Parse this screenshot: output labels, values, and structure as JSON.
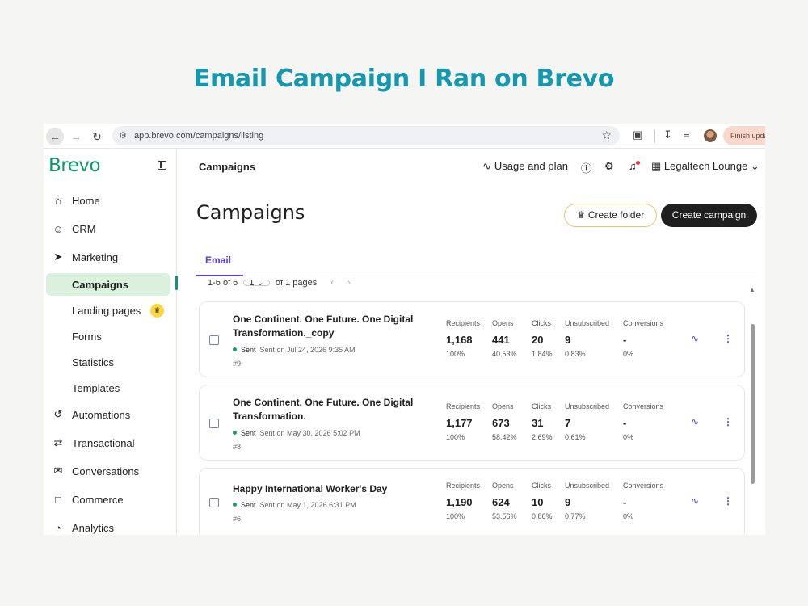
{
  "headline": "Email Campaign I Ran on Brevo",
  "browser": {
    "url": "app.brevo.com/campaigns/listing",
    "finish_label": "Finish upda"
  },
  "sidebar": {
    "logo": "Brevo",
    "items": [
      {
        "label": "Home",
        "icon": "home-icon"
      },
      {
        "label": "CRM",
        "icon": "user-circle-icon"
      },
      {
        "label": "Marketing",
        "icon": "send-icon"
      },
      {
        "label": "Automations",
        "icon": "automation-icon"
      },
      {
        "label": "Transactional",
        "icon": "transfer-icon"
      },
      {
        "label": "Conversations",
        "icon": "chat-icon"
      },
      {
        "label": "Commerce",
        "icon": "shopping-bag-icon"
      },
      {
        "label": "Analytics",
        "icon": "pie-chart-icon"
      }
    ],
    "marketing_sub": [
      {
        "label": "Campaigns",
        "active": true
      },
      {
        "label": "Landing pages"
      },
      {
        "label": "Forms"
      },
      {
        "label": "Statistics"
      },
      {
        "label": "Templates"
      }
    ]
  },
  "topbar": {
    "title": "Campaigns",
    "usage": "Usage and plan",
    "account": "Legaltech Lounge"
  },
  "page": {
    "title": "Campaigns",
    "create_folder": "Create folder",
    "create_campaign": "Create campaign",
    "tab": "Email",
    "pager_range": "1-6 of 6",
    "pager_page": "1",
    "pager_total": "of 1 pages"
  },
  "stat_labels": {
    "recipients": "Recipients",
    "opens": "Opens",
    "clicks": "Clicks",
    "unsubscribed": "Unsubscribed",
    "conversions": "Conversions"
  },
  "campaigns": [
    {
      "title": "One Continent. One Future. One Digital Transformation._copy",
      "status": "Sent",
      "sent_on": "Sent on Jul 24, 2026 9:35 AM",
      "id": "#9",
      "recipients": "1,168",
      "recipients_pct": "100%",
      "opens": "441",
      "opens_pct": "40.53%",
      "clicks": "20",
      "clicks_pct": "1.84%",
      "unsubscribed": "9",
      "unsubscribed_pct": "0.83%",
      "conversions": "-",
      "conversions_pct": "0%"
    },
    {
      "title": "One Continent. One Future. One Digital Transformation.",
      "status": "Sent",
      "sent_on": "Sent on May 30, 2026 5:02 PM",
      "id": "#8",
      "recipients": "1,177",
      "recipients_pct": "100%",
      "opens": "673",
      "opens_pct": "58.42%",
      "clicks": "31",
      "clicks_pct": "2.69%",
      "unsubscribed": "7",
      "unsubscribed_pct": "0.61%",
      "conversions": "-",
      "conversions_pct": "0%"
    },
    {
      "title": "Happy International Worker's Day",
      "status": "Sent",
      "sent_on": "Sent on May 1, 2026 6:31 PM",
      "id": "#6",
      "recipients": "1,190",
      "recipients_pct": "100%",
      "opens": "624",
      "opens_pct": "53.56%",
      "clicks": "10",
      "clicks_pct": "0.86%",
      "unsubscribed": "9",
      "unsubscribed_pct": "0.77%",
      "conversions": "-",
      "conversions_pct": "0%"
    }
  ],
  "colors": {
    "brand_green": "#0b996e",
    "headline_teal": "#1598ad",
    "accent_purple": "#5a3ee0",
    "status_green": "#13a36b"
  }
}
